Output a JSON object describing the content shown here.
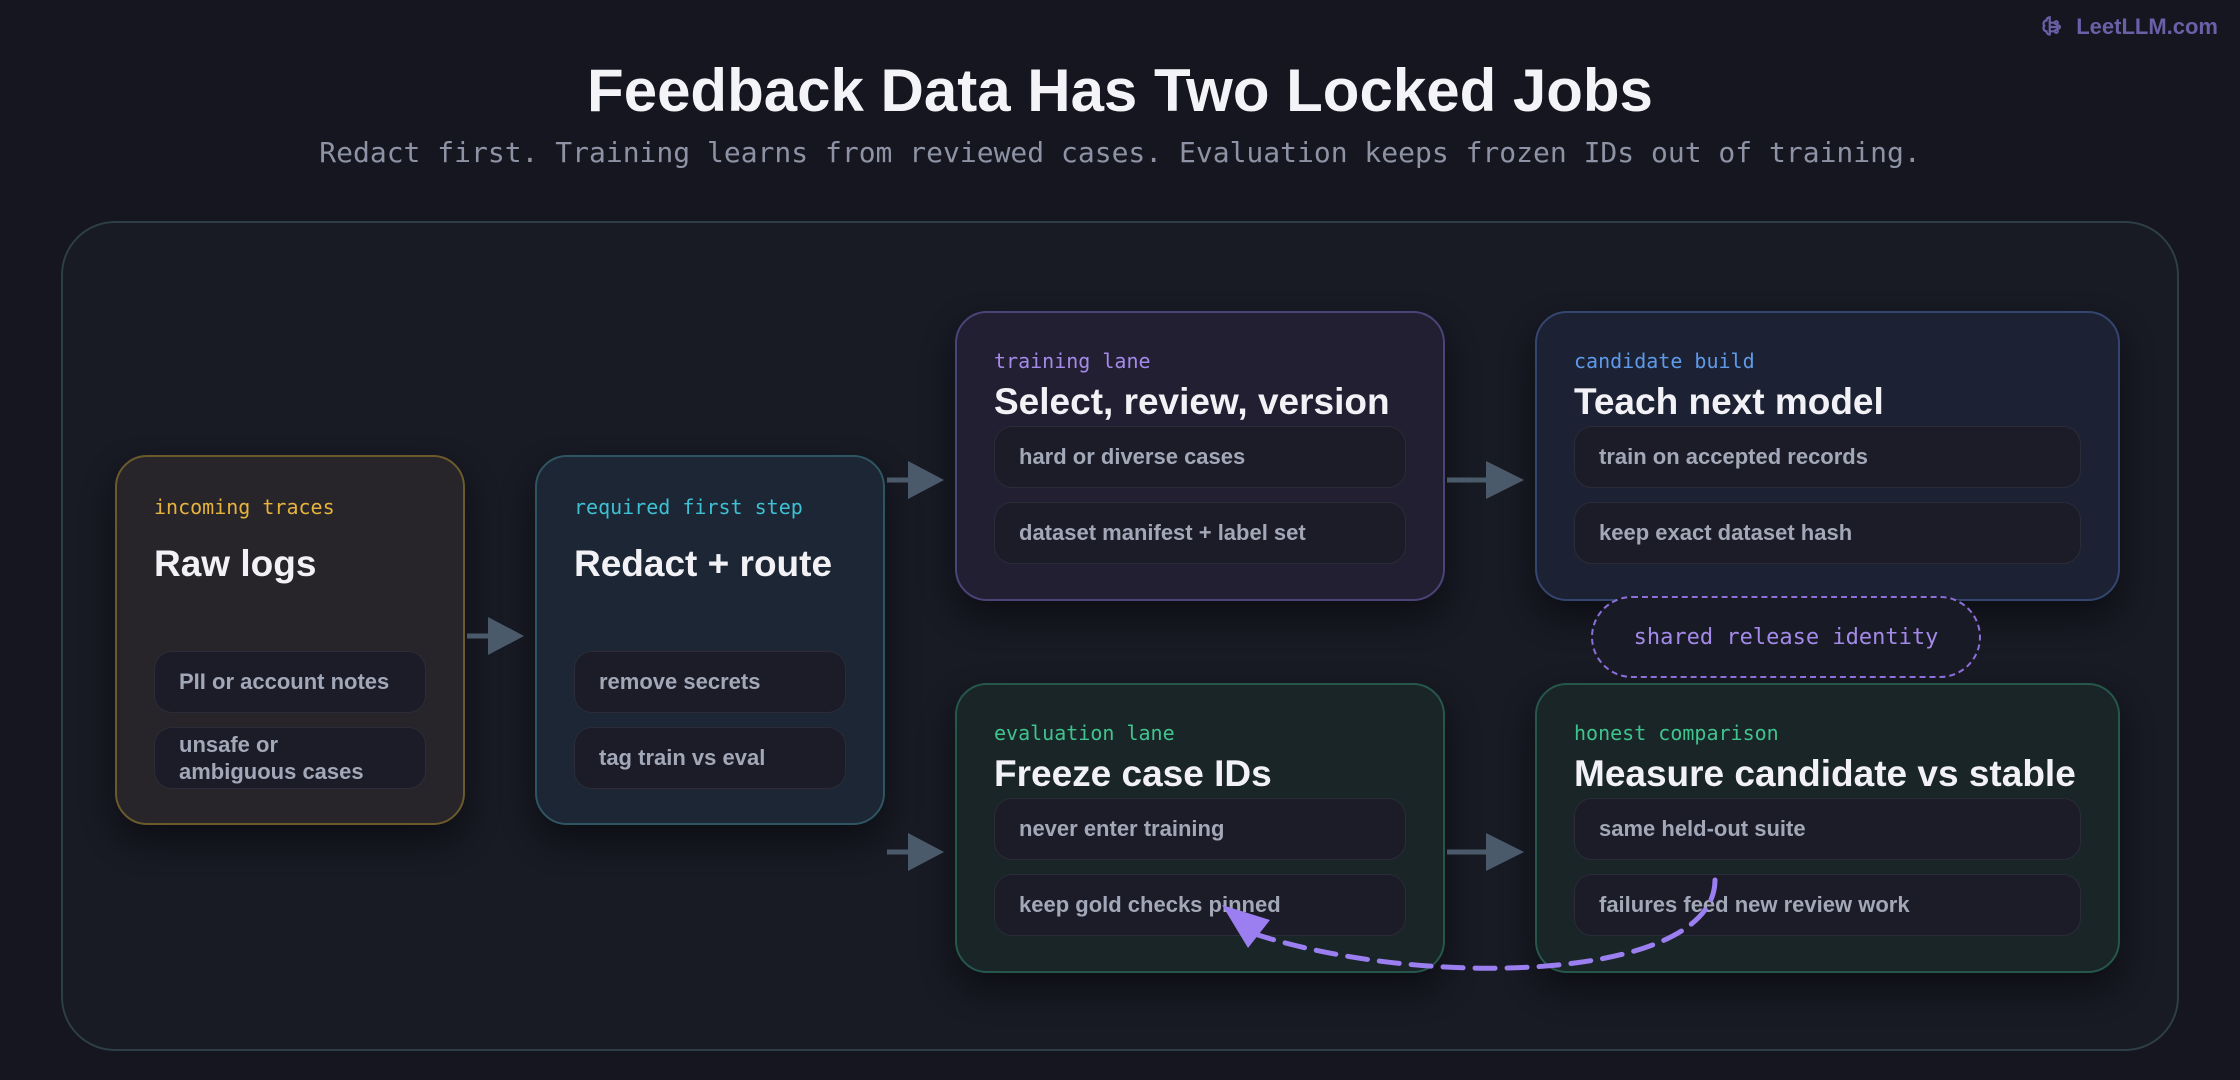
{
  "brand": {
    "name": "LeetLLM.com",
    "icon": "brain-icon"
  },
  "header": {
    "title": "Feedback Data Has Two Locked Jobs",
    "subtitle": "Redact first. Training learns from reviewed cases. Evaluation keeps frozen IDs out of training."
  },
  "cards": {
    "raw": {
      "kicker": "incoming traces",
      "heading": "Raw logs",
      "items": [
        "PII or account notes",
        "unsafe or\nambiguous cases"
      ]
    },
    "redact": {
      "kicker": "required first step",
      "heading": "Redact + route",
      "items": [
        "remove secrets",
        "tag train vs eval"
      ]
    },
    "train": {
      "kicker": "training lane",
      "heading": "Select, review, version",
      "items": [
        "hard or diverse cases",
        "dataset manifest + label set"
      ]
    },
    "candidate": {
      "kicker": "candidate build",
      "heading": "Teach next model",
      "items": [
        "train on accepted records",
        "keep exact dataset hash"
      ]
    },
    "eval": {
      "kicker": "evaluation lane",
      "heading": "Freeze case IDs",
      "items": [
        "never enter training",
        "keep gold checks pinned"
      ]
    },
    "compare": {
      "kicker": "honest comparison",
      "heading": "Measure candidate vs stable",
      "items": [
        "same held-out suite",
        "failures feed new review work"
      ]
    }
  },
  "shared_identity": "shared release identity",
  "colors": {
    "background": "#15161f",
    "arrow": "#4b5a6b",
    "feedback_arrow": "#9b7ff0",
    "traces_accent": "#e6b33c",
    "redact_accent": "#3ec1d3",
    "training_accent": "#a48ae8",
    "candidate_accent": "#5f9ae8",
    "evaluation_accent": "#3fc48d"
  }
}
